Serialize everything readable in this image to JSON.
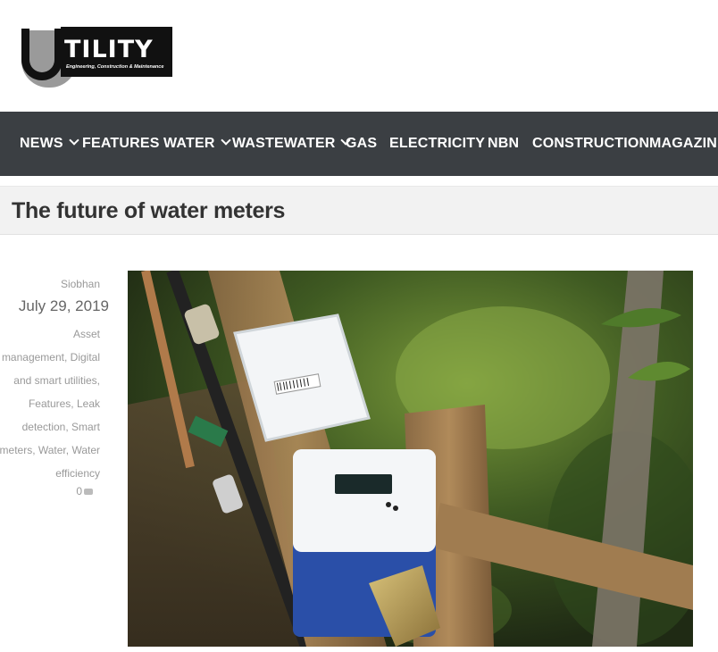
{
  "logo": {
    "letter": "U",
    "word": "TILITY",
    "tagline": "Engineering, Construction & Maintenance"
  },
  "nav": {
    "items": [
      {
        "label": "NEWS",
        "dropdown": true
      },
      {
        "label": "FEATURES",
        "dropdown": false
      },
      {
        "label": "WATER",
        "dropdown": true
      },
      {
        "label": "WASTEWATER",
        "dropdown": true
      },
      {
        "label": "GAS",
        "dropdown": false
      },
      {
        "label": "ELECTRICITY",
        "dropdown": false
      },
      {
        "label": "NBN",
        "dropdown": false
      },
      {
        "label": "CONSTRUCTION",
        "dropdown": false
      },
      {
        "label": "MAGAZINE",
        "dropdown": false
      }
    ]
  },
  "article": {
    "title": "The future of water meters",
    "author": "Siobhan",
    "date": "July 29, 2019",
    "categories": [
      "Asset",
      "management, Digital",
      "and smart utilities,",
      "Features, Leak",
      "detection, Smart",
      "meters, Water, Water",
      "efficiency"
    ],
    "comment_count": "0"
  },
  "colors": {
    "nav_bg": "#3b3f43",
    "title_bar_bg": "#f2f2f2"
  }
}
